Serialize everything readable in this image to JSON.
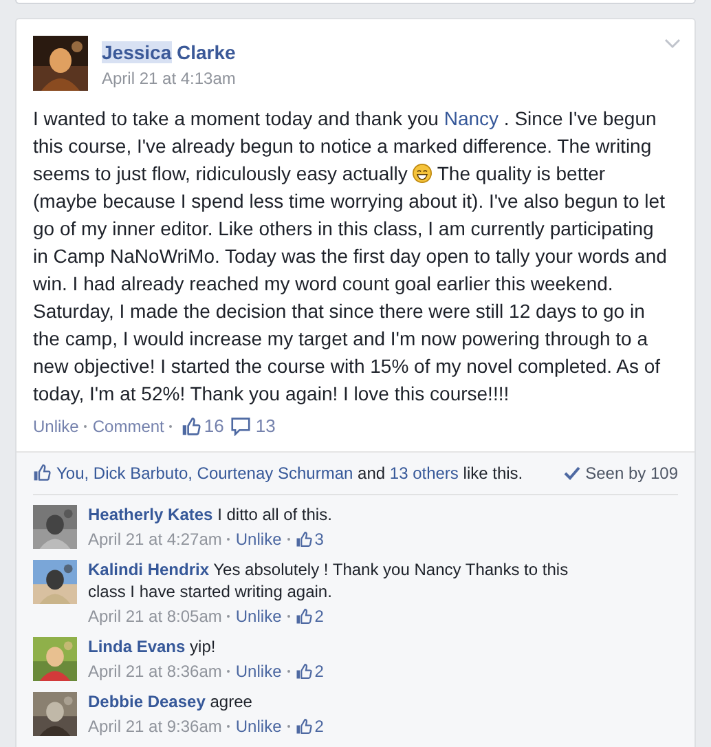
{
  "post": {
    "author": {
      "first_name": "Jessica",
      "last_name": "Clarke",
      "first_name_selected": true
    },
    "time": "April 21 at 4:13am",
    "body": [
      {
        "kind": "text",
        "text": "I wanted to take a moment today and thank you "
      },
      {
        "kind": "mention",
        "text": "Nancy"
      },
      {
        "kind": "text",
        "text": " . Since I've begun this course, I've already begun to notice a marked difference. The writing seems to just flow, ridiculously easy actually "
      },
      {
        "kind": "emoji"
      },
      {
        "kind": "text",
        "text": " The quality is better (maybe because I spend less time worrying about it). I've also begun to let go of my inner editor. Like others in this class, I am currently participating in Camp NaNoWriMo. Today was the first day open to tally your words and win. I had already reached my word count goal earlier this weekend. Saturday, I made the decision that since there were still 12 days to go in the camp, I would increase my target and I'm now powering through to a new objective! I started the course with 15% of my novel completed. As of today, I'm at 52%! Thank you again! I love this course!!!!"
      }
    ],
    "actions": [
      "Unlike",
      "Comment"
    ],
    "like_count": "16",
    "comment_count": "13"
  },
  "likes_bar": {
    "names": "You, Dick Barbuto, Courtenay Schurman",
    "and": "and",
    "others": "13 others",
    "suffix": "like this.",
    "seen": "Seen by 109"
  },
  "comments": [
    {
      "name": "Heatherly Kates",
      "text": "I ditto all of this.",
      "time": "April 21 at 4:27am",
      "action": "Unlike",
      "likes": "3"
    },
    {
      "name": "Kalindi Hendrix",
      "text": "Yes absolutely ! Thank you Nancy Thanks to this class I have started writing again.",
      "time": "April 21 at 8:05am",
      "action": "Unlike",
      "likes": "2"
    },
    {
      "name": "Linda Evans",
      "text": "yip!",
      "time": "April 21 at 8:36am",
      "action": "Unlike",
      "likes": "2"
    },
    {
      "name": "Debbie Deasey",
      "text": "agree",
      "time": "April 21 at 9:36am",
      "action": "Unlike",
      "likes": "2"
    }
  ]
}
